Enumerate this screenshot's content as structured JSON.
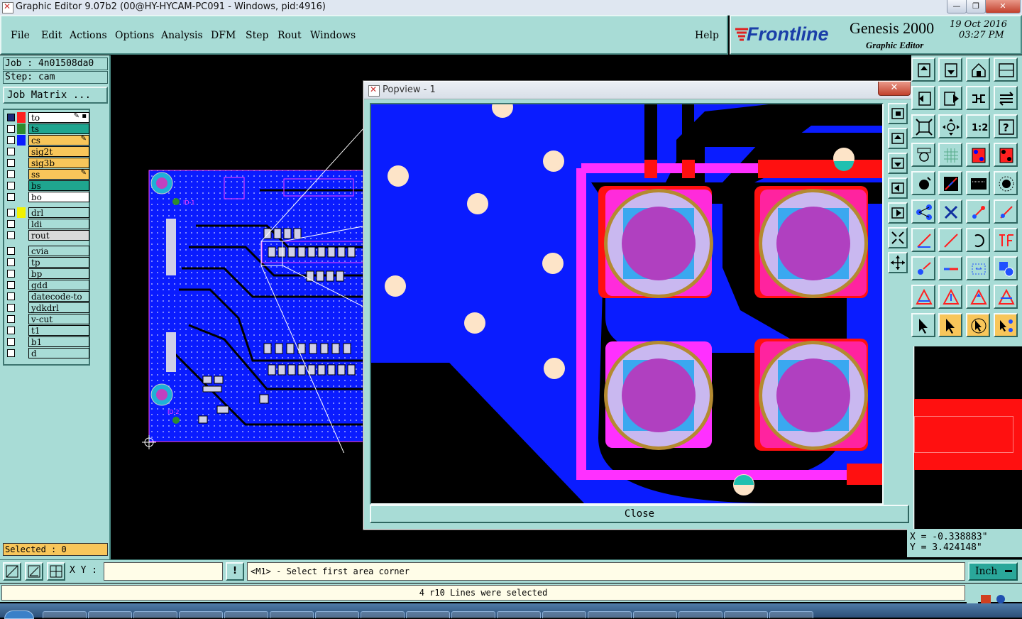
{
  "window": {
    "title": "Graphic Editor 9.07b2 (00@HY-HYCAM-PC091 - Windows, pid:4916)",
    "min_label": "—",
    "max_label": "❐",
    "close_label": "✕"
  },
  "menu": {
    "file": "File",
    "edit": "Edit",
    "actions": "Actions",
    "options": "Options",
    "analysis": "Analysis",
    "dfm": "DFM",
    "step": "Step",
    "rout": "Rout",
    "windows": "Windows",
    "help": "Help"
  },
  "brand": {
    "logo": "Frontline",
    "product": "Genesis 2000",
    "subtitle": "Graphic Editor",
    "date": "19 Oct 2016",
    "time": "03:27 PM"
  },
  "job": {
    "job_label": "Job : 4n01508da0",
    "step_label": "Step: cam",
    "matrix_button": "Job Matrix ..."
  },
  "layers": [
    {
      "name": "to",
      "swatch": "#ff2020",
      "bg": "#ffffff",
      "mark": "✎ ▪"
    },
    {
      "name": "ts",
      "swatch": "#2e8b2e",
      "bg": "#1fa58f",
      "mark": ""
    },
    {
      "name": "cs",
      "swatch": "#0a1cff",
      "bg": "#f8c65a",
      "mark": "✎"
    },
    {
      "name": "sig2t",
      "swatch": "",
      "bg": "#f8c65a",
      "mark": ""
    },
    {
      "name": "sig3b",
      "swatch": "",
      "bg": "#f8c65a",
      "mark": ""
    },
    {
      "name": "ss",
      "swatch": "",
      "bg": "#f8c65a",
      "mark": "✎"
    },
    {
      "name": "bs",
      "swatch": "",
      "bg": "#1fa58f",
      "mark": ""
    },
    {
      "name": "bo",
      "swatch": "",
      "bg": "#ffffff",
      "mark": ""
    },
    {
      "name": "drl",
      "swatch": "#f2f200",
      "bg": "#a8dcd6",
      "mark": ""
    },
    {
      "name": "ldi",
      "swatch": "",
      "bg": "#a8dcd6",
      "mark": ""
    },
    {
      "name": "rout",
      "swatch": "",
      "bg": "#d8dada",
      "mark": ""
    },
    {
      "name": "cvia",
      "swatch": "",
      "bg": "#a8dcd6",
      "mark": ""
    },
    {
      "name": "tp",
      "swatch": "",
      "bg": "#a8dcd6",
      "mark": ""
    },
    {
      "name": "bp",
      "swatch": "",
      "bg": "#a8dcd6",
      "mark": ""
    },
    {
      "name": "gdd",
      "swatch": "",
      "bg": "#a8dcd6",
      "mark": ""
    },
    {
      "name": "datecode-to",
      "swatch": "",
      "bg": "#a8dcd6",
      "mark": ""
    },
    {
      "name": "ydkdrl",
      "swatch": "",
      "bg": "#a8dcd6",
      "mark": ""
    },
    {
      "name": "v-cut",
      "swatch": "",
      "bg": "#a8dcd6",
      "mark": ""
    },
    {
      "name": "t1",
      "swatch": "",
      "bg": "#a8dcd6",
      "mark": ""
    },
    {
      "name": "b1",
      "swatch": "",
      "bg": "#a8dcd6",
      "mark": ""
    },
    {
      "name": "d",
      "swatch": "",
      "bg": "#a8dcd6",
      "mark": ""
    }
  ],
  "selected_label": "Selected : 0",
  "popview": {
    "title": "Popview - 1",
    "close_button": "Close",
    "close_x": "✕"
  },
  "coords": {
    "x": "X = -0.338883\"",
    "y": "Y = 3.424148\""
  },
  "command": {
    "xy_label": "X Y :",
    "xy_value": "",
    "bang": "!",
    "prompt": "<M1> - Select first area corner",
    "unit": "Inch"
  },
  "status": {
    "message": "4 r10 Lines were selected"
  },
  "board_labels": {
    "label1": "ID-1",
    "label2": "ID-2"
  },
  "colors": {
    "panel": "#a8dcd6",
    "copper": "#0a1cff",
    "top_layer": "#ff2020",
    "mask": "#ff20ff",
    "accent": "#f8c65a"
  }
}
